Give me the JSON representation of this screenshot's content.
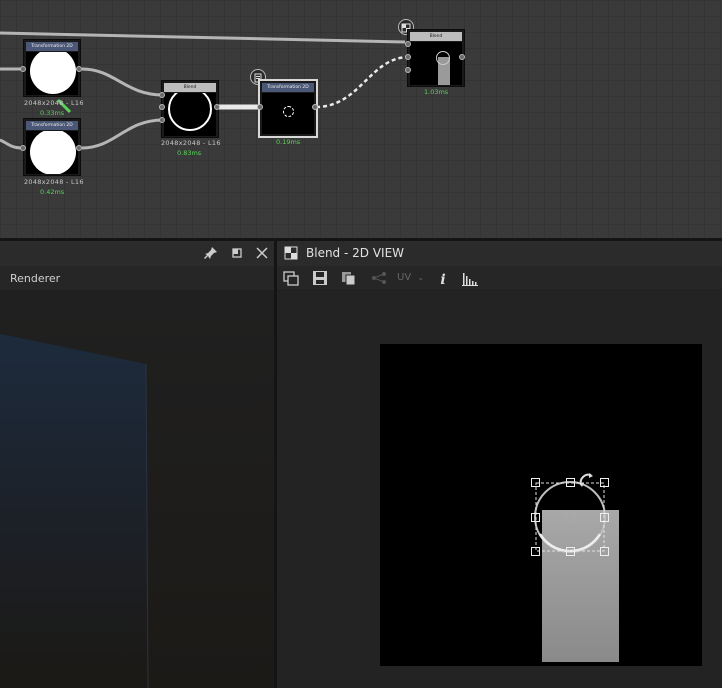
{
  "graph": {
    "nodes": [
      {
        "title": "Transformation 2D",
        "res": "2048x2048 - L16",
        "time": "0.33ms"
      },
      {
        "title": "Transformation 2D",
        "res": "2048x2048 - L16",
        "time": "0.42ms"
      },
      {
        "title": "Blend",
        "res": "2048x2048 - L16",
        "time": "0.83ms"
      },
      {
        "title": "Transformation 2D",
        "time": "0.19ms"
      },
      {
        "title": "Blend",
        "time": "1.03ms"
      }
    ]
  },
  "renderer_panel": {
    "title": "Renderer"
  },
  "view_panel": {
    "title": "Blend - 2D VIEW",
    "uv_label": "UV"
  },
  "colors": {
    "accent_green": "#5bd35b",
    "node_header_blue": "#4a5776",
    "node_header_gray": "#bdbdbd"
  }
}
